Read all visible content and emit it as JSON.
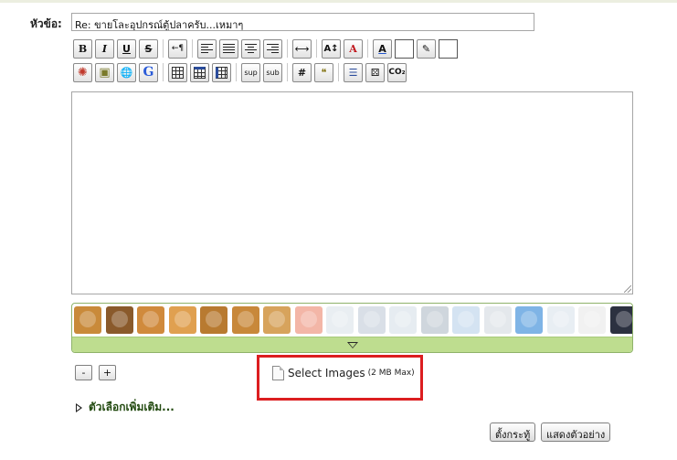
{
  "subject": {
    "label": "หัวข้อ:",
    "value": "Re: ขายโละอุปกรณ์ตู้ปลาครับ...เหมาๆ"
  },
  "toolbar_row1": [
    {
      "icon": "bold-icon",
      "text": "B"
    },
    {
      "icon": "italic-icon",
      "text": "I"
    },
    {
      "icon": "underline-icon",
      "text": "U"
    },
    {
      "icon": "strikethrough-icon",
      "text": "S"
    },
    {
      "icon": "separator"
    },
    {
      "icon": "text-direction-icon",
      "text": "←¶"
    },
    {
      "icon": "separator"
    },
    {
      "icon": "align-left-icon"
    },
    {
      "icon": "align-justify-icon"
    },
    {
      "icon": "align-center-icon"
    },
    {
      "icon": "align-right-icon"
    },
    {
      "icon": "separator"
    },
    {
      "icon": "horizontal-rule-icon",
      "text": "⟷"
    },
    {
      "icon": "separator"
    },
    {
      "icon": "font-size-icon",
      "text": "A↕"
    },
    {
      "icon": "font-face-icon",
      "text": "A"
    },
    {
      "icon": "separator"
    },
    {
      "icon": "text-color-icon",
      "text": "A"
    },
    {
      "icon": "text-color-swatch"
    },
    {
      "icon": "highlight-color-icon",
      "text": "✎"
    },
    {
      "icon": "highlight-color-swatch"
    }
  ],
  "toolbar_row2": [
    {
      "icon": "flash-icon",
      "text": "✺"
    },
    {
      "icon": "image-icon",
      "text": "▣"
    },
    {
      "icon": "link-icon",
      "text": "🌐"
    },
    {
      "icon": "google-icon",
      "text": "G"
    },
    {
      "icon": "separator"
    },
    {
      "icon": "table-icon"
    },
    {
      "icon": "table-header-icon"
    },
    {
      "icon": "table-cell-icon"
    },
    {
      "icon": "separator"
    },
    {
      "icon": "superscript-icon",
      "text": "sup"
    },
    {
      "icon": "subscript-icon",
      "text": "sub"
    },
    {
      "icon": "separator"
    },
    {
      "icon": "code-icon",
      "text": "#"
    },
    {
      "icon": "quote-icon",
      "text": "❝"
    },
    {
      "icon": "separator"
    },
    {
      "icon": "list-icon",
      "text": "☰"
    },
    {
      "icon": "dice-icon",
      "text": "⚄"
    },
    {
      "icon": "co2-icon",
      "text": "CO₂"
    }
  ],
  "smileys": [
    {
      "name": "smiley-monkey-1",
      "color": "#c98a3a"
    },
    {
      "name": "smiley-monkey-2",
      "color": "#8a5a2b"
    },
    {
      "name": "smiley-monkey-3",
      "color": "#d08a3c"
    },
    {
      "name": "smiley-monkey-4",
      "color": "#e0a050"
    },
    {
      "name": "smiley-monkey-5",
      "color": "#b87a30"
    },
    {
      "name": "smiley-monkey-6",
      "color": "#c8883a"
    },
    {
      "name": "smiley-monkey-7",
      "color": "#d7a35c"
    },
    {
      "name": "smiley-pig-1",
      "color": "#f3b6a7"
    },
    {
      "name": "smiley-onion-1",
      "color": "#e9eef2"
    },
    {
      "name": "smiley-onion-2",
      "color": "#d9dfe7"
    },
    {
      "name": "smiley-onion-3",
      "color": "#e6ecf1"
    },
    {
      "name": "smiley-onion-4",
      "color": "#cfd6dd"
    },
    {
      "name": "smiley-onion-5",
      "color": "#d4e3f2"
    },
    {
      "name": "smiley-onion-6",
      "color": "#e4e8ec"
    },
    {
      "name": "smiley-onion-7",
      "color": "#7fb4e6"
    },
    {
      "name": "smiley-onion-8",
      "color": "#e8eef3"
    },
    {
      "name": "smiley-onion-9",
      "color": "#f1f1f1"
    },
    {
      "name": "smiley-onion-10",
      "color": "#2c3140"
    }
  ],
  "zoom": {
    "minus": "-",
    "plus": "+"
  },
  "upload": {
    "label": "Select Images",
    "max": "(2 MB Max)"
  },
  "more_options": "ตัวเลือกเพิ่มเติม...",
  "buttons": {
    "submit": "ตั้งกระทู้",
    "preview": "แสดงตัวอย่าง"
  },
  "colors": {
    "highlight_border": "#dc1e20",
    "smiley_bar": "#bedd8f"
  }
}
